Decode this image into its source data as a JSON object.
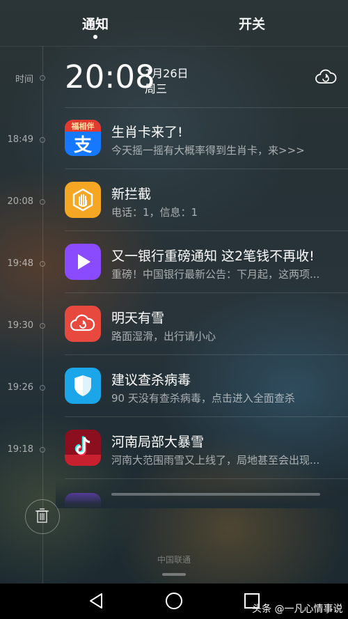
{
  "tabs": {
    "notify": "通知",
    "switch": "开关"
  },
  "header": {
    "time_label": "时间",
    "clock": "20:08",
    "date": "1月26日",
    "weekday": "周三",
    "weather_icon": "cloud-refresh-icon"
  },
  "notifications": [
    {
      "time": "18:49",
      "icon": "alipay-icon",
      "title": "生肖卡来了!",
      "body": "今天摇一摇有大概率得到生肖卡，来>>>"
    },
    {
      "time": "20:08",
      "icon": "hand-block-icon",
      "title": "新拦截",
      "body": "电话：1，信息：1"
    },
    {
      "time": "19:48",
      "icon": "video-play-icon",
      "title": "又一银行重磅通知 这2笔钱不再收!",
      "body": "重磅！中国银行最新公告：下月起，这两项..."
    },
    {
      "time": "19:30",
      "icon": "weather-cloud-icon",
      "title": "明天有雪",
      "body": "路面湿滑，出行请小心"
    },
    {
      "time": "19:26",
      "icon": "security-shield-icon",
      "title": "建议查杀病毒",
      "body": "90 天没有查杀病毒，点击进入全面查杀"
    },
    {
      "time": "19:18",
      "icon": "douyin-icon",
      "title": "河南局部大暴雪",
      "body": "河南大范围雨雪又上线了，局地甚至会出现..."
    }
  ],
  "alipay_badge": "福相伴",
  "alipay_char": "支",
  "carrier": "中国联通",
  "watermark": "头条 @一凡心情事说",
  "colors": {
    "alipay_blue": "#1677ff",
    "block_orange": "#f5a623",
    "video_purple": "#8a4bff",
    "weather_red": "#e8493f",
    "shield_blue": "#1aa6e8",
    "douyin_dark": "#8b0f1e"
  }
}
